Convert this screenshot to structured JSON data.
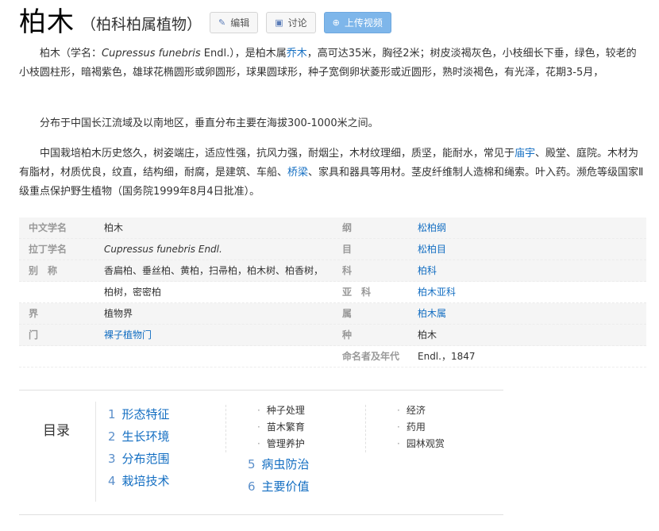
{
  "header": {
    "title": "柏木",
    "subtitle": "（柏科柏属植物）",
    "edit_label": "编辑",
    "discuss_label": "讨论",
    "upload_label": "上传视频"
  },
  "intro": {
    "p1_a": "柏木（学名：",
    "p1_latin": "Cupressus funebris",
    "p1_b": " Endl.），是柏木属",
    "p1_link": "乔木",
    "p1_c": "，高可达35米，胸径2米；树皮淡褐灰色，小枝细长下垂，绿色，较老的小枝圆柱形，暗褐紫色，雄球花椭圆形或卵圆形，球果圆球形，种子宽倒卵状菱形或近圆形，熟时淡褐色，有光泽，花期3-5月，",
    "p2": "分布于中国长江流域及以南地区，垂直分布主要在海拔300-1000米之间。",
    "p3_a": "中国栽培柏木历史悠久，树姿端庄，适应性强，抗风力强，耐烟尘，木材纹理细，质坚，能耐水，常见于",
    "p3_link1": "庙宇",
    "p3_b": "、殿堂、庭院。木材为有脂材，材质优良，纹直，结构细，耐腐，是建筑、车船、",
    "p3_link2": "桥梁",
    "p3_c": "、家具和器具等用材。茎皮纤维制人造棉和绳索。叶入药。濒危等级国家Ⅱ级重点保护野生植物（国务院1999年8月4日批准）。"
  },
  "info": {
    "left": [
      {
        "key": "中文学名",
        "value": "柏木"
      },
      {
        "key": "拉丁学名",
        "value": "Cupressus funebris Endl."
      },
      {
        "key": "别　称",
        "value": "香扁柏、垂丝柏、黄柏，扫帚柏，柏木树、柏香树，",
        "value2": "柏树，密密柏"
      },
      {
        "key": "界",
        "value": "植物界"
      },
      {
        "key": "门",
        "value": "裸子植物门"
      }
    ],
    "right": [
      {
        "key": "纲",
        "value": "松柏纲"
      },
      {
        "key": "目",
        "value": "松柏目"
      },
      {
        "key": "科",
        "value": "柏科"
      },
      {
        "key": "亚　科",
        "value": "柏木亚科"
      },
      {
        "key": "属",
        "value": "柏木属"
      },
      {
        "key": "种",
        "value": "柏木"
      },
      {
        "key": "命名者及年代",
        "value": "Endl.，1847"
      }
    ]
  },
  "toc": {
    "label": "目录",
    "items": [
      {
        "num": "1",
        "label": "形态特征"
      },
      {
        "num": "2",
        "label": "生长环境"
      },
      {
        "num": "3",
        "label": "分布范围"
      },
      {
        "num": "4",
        "label": "栽培技术"
      },
      {
        "num": "5",
        "label": "病虫防治"
      },
      {
        "num": "6",
        "label": "主要价值"
      }
    ],
    "sub4": [
      "种子处理",
      "苗木繁育",
      "管理养护"
    ],
    "sub6": [
      "经济",
      "药用",
      "园林观赏"
    ]
  }
}
